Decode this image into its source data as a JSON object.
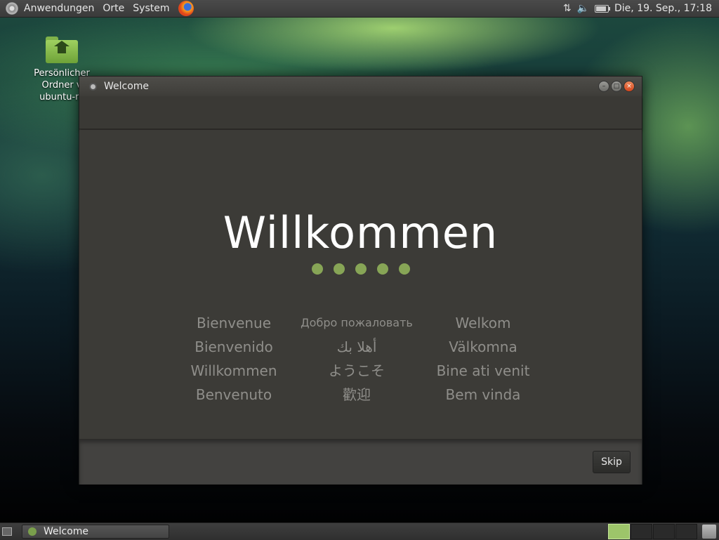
{
  "top_panel": {
    "menus": [
      "Anwendungen",
      "Orte",
      "System"
    ],
    "datetime": "Die, 19. Sep., 17:18"
  },
  "desktop": {
    "icon_label_lines": [
      "Persönlicher",
      "Ordner v",
      "ubuntu-m"
    ]
  },
  "window": {
    "title": "Welcome",
    "heading": "Willkommen",
    "greetings": [
      "Bienvenue",
      "Добро пожаловать",
      "Welkom",
      "Bienvenido",
      "أهلا بك",
      "Välkomna",
      "Willkommen",
      "ようこそ",
      "Bine ati venit",
      "Benvenuto",
      "歡迎",
      "Bem vinda"
    ],
    "skip_label": "Skip"
  },
  "taskbar": {
    "task_label": "Welcome"
  },
  "colors": {
    "accent_dots": "#87a556",
    "close_button": "#e0562a"
  }
}
